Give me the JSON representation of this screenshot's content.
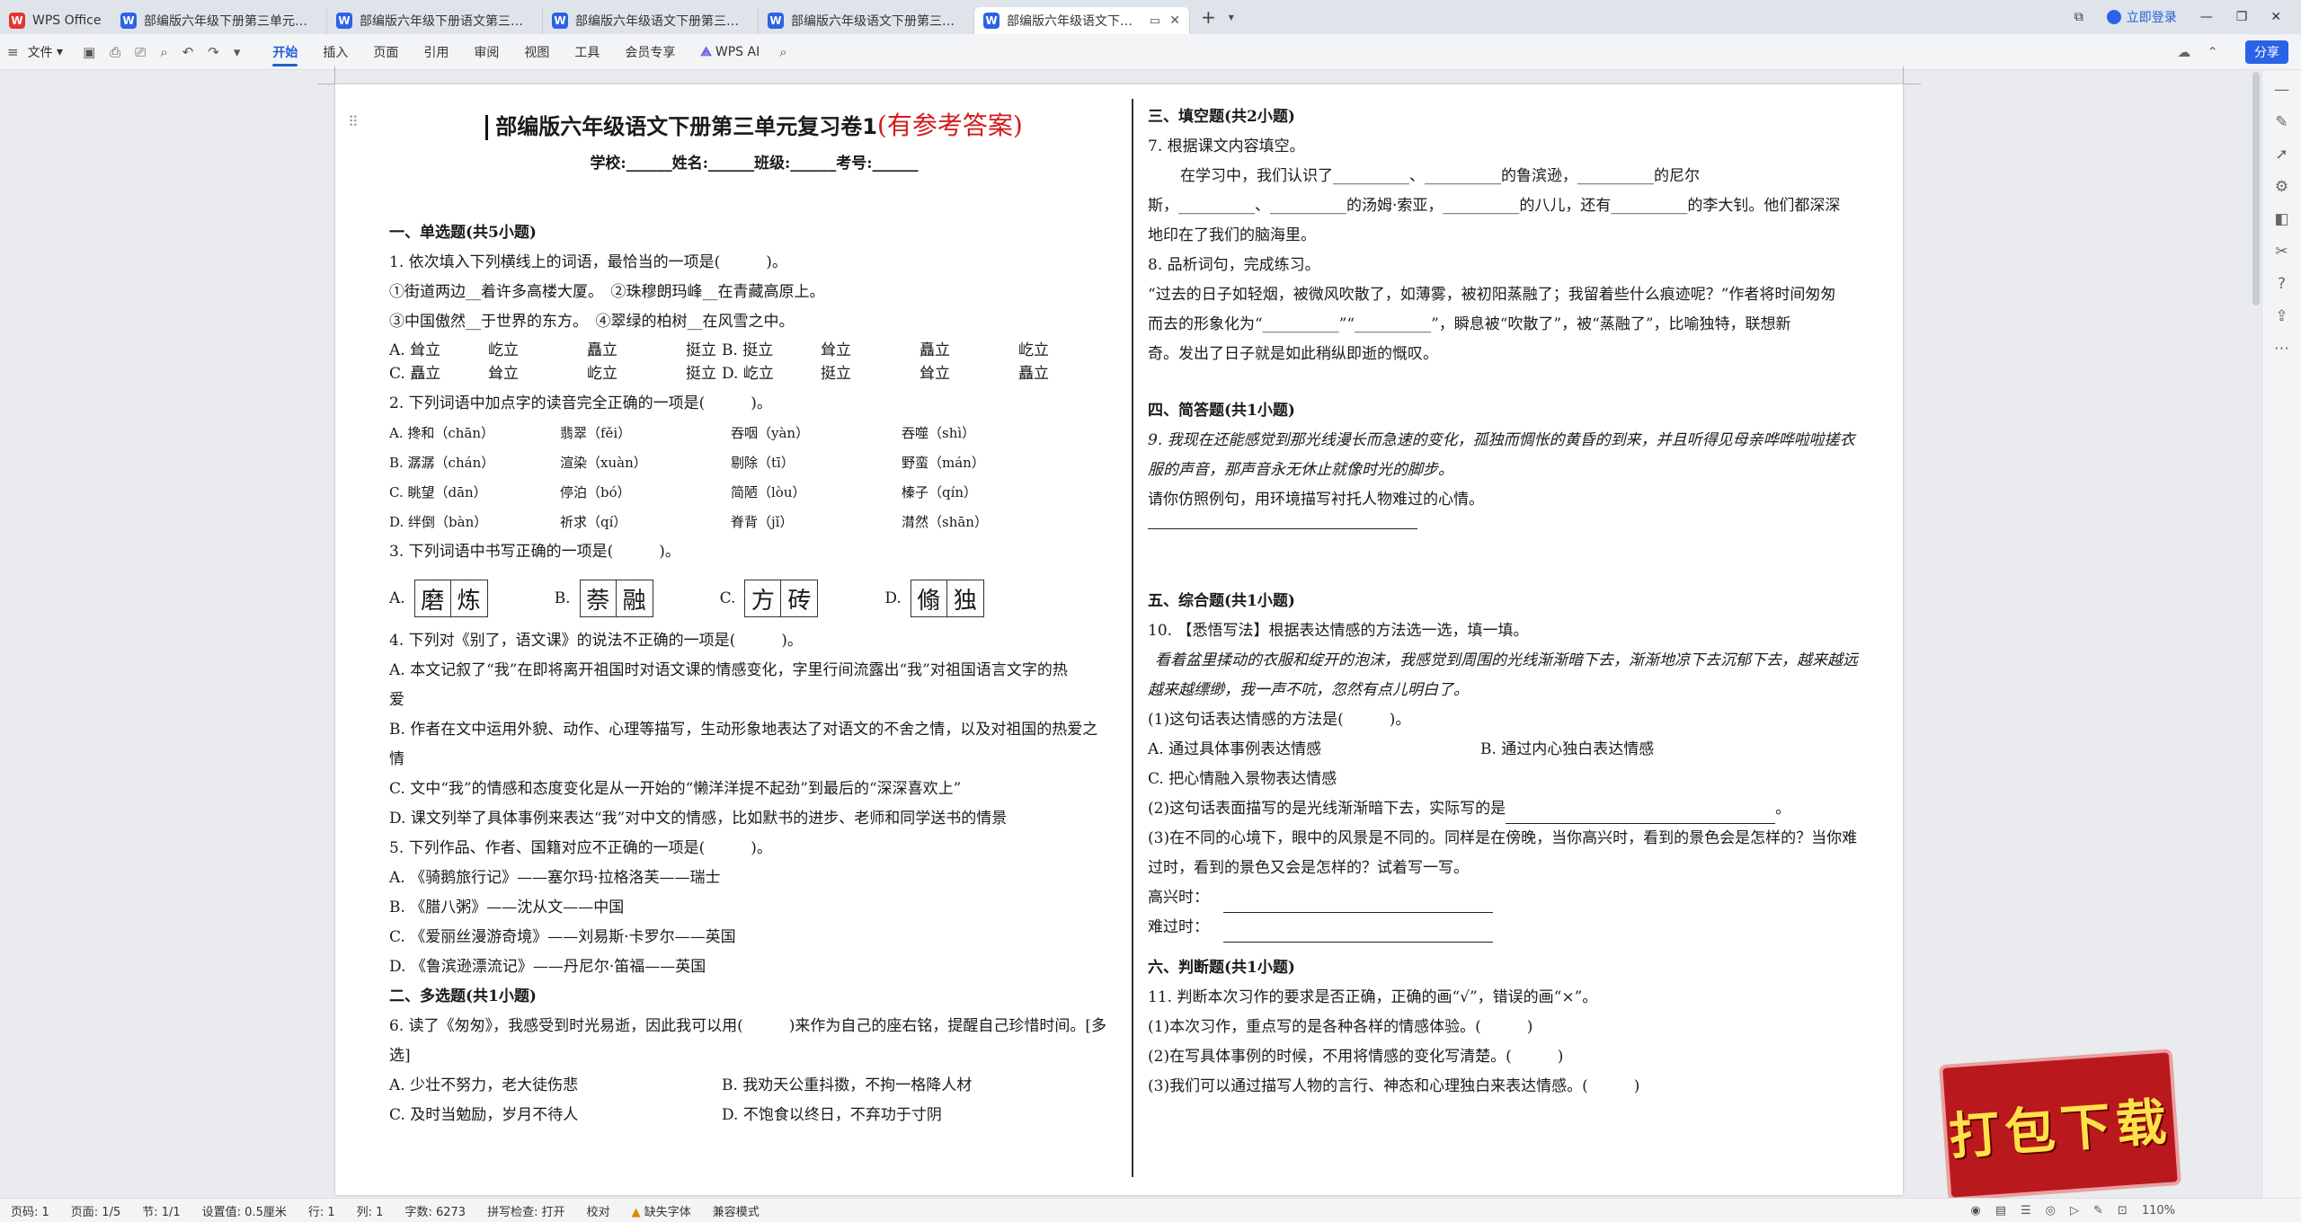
{
  "tabs": [
    {
      "label": "WPS Office",
      "icon": "wps-logo"
    },
    {
      "label": "部编版六年级下册第三单元复习卷.docx",
      "icon": "word-doc-icon"
    },
    {
      "label": "部编版六年级下册语文第三单元测试卷",
      "icon": "word-doc-icon"
    },
    {
      "label": "部编版六年级语文下册第三单元测试卷",
      "icon": "word-doc-icon"
    },
    {
      "label": "部编版六年级语文下册第三单元",
      "icon": "word-doc-icon"
    },
    {
      "label": "部编版六年级语文下册第三单元",
      "icon": "word-doc-icon"
    }
  ],
  "titlebar": {
    "login": "立即登录"
  },
  "menu": {
    "file": "文件",
    "items": [
      "开始",
      "插入",
      "页面",
      "引用",
      "审阅",
      "视图",
      "工具",
      "会员专享"
    ],
    "ai": "WPS AI",
    "share": "分享"
  },
  "doc": {
    "title": "部编版六年级语文下册第三单元复习卷1",
    "title_red": "(有参考答案)",
    "subtitle": "学校:______姓名:______班级:______考号:______",
    "s1": "一、单选题(共5小题)",
    "q1": "1. 依次填入下列横线上的词语，最恰当的一项是(　　　)。",
    "q1a": "①街道两边__着许多高楼大厦。　②珠穆朗玛峰__在青藏高原上。",
    "q1b": "③中国傲然__于世界的东方。　④翠绿的柏树__在风雪之中。",
    "q1o1": [
      "A. 耸立",
      "屹立",
      "矗立",
      "挺立"
    ],
    "q1o2": [
      "B. 挺立",
      "耸立",
      "矗立",
      "屹立"
    ],
    "q1o3": [
      "C. 矗立",
      "耸立",
      "屹立",
      "挺立"
    ],
    "q1o4": [
      "D. 屹立",
      "挺立",
      "耸立",
      "矗立"
    ],
    "q2": "2. 下列词语中加点字的读音完全正确的一项是(　　　)。",
    "q2a": [
      "A. 搀和（chān）",
      "翡翠（fěi）",
      "吞咽（yàn）",
      "吞噬（shì）"
    ],
    "q2b": [
      "B. 潺潺（chán）",
      "渲染（xuàn）",
      "剔除（tī）",
      "野蛮（mán）"
    ],
    "q2c": [
      "C. 眺望（dān）",
      "停泊（bó）",
      "简陋（lòu）",
      "榛子（qín）"
    ],
    "q2d": [
      "D. 绊倒（bàn）",
      "祈求（qí）",
      "脊背（jǐ）",
      "潸然（shān）"
    ],
    "q3": "3. 下列词语中书写正确的一项是(　　　)。",
    "q3opts": [
      {
        "l": "A.",
        "c": [
          "磨",
          "炼"
        ]
      },
      {
        "l": "B.",
        "c": [
          "萘",
          "融"
        ]
      },
      {
        "l": "C.",
        "c": [
          "方",
          "砖"
        ]
      },
      {
        "l": "D.",
        "c": [
          "翛",
          "独"
        ]
      }
    ],
    "q4": "4. 下列对《别了，语文课》的说法不正确的一项是(　　　)。",
    "q4a": "A. 本文记叙了“我”在即将离开祖国时对语文课的情感变化，字里行间流露出“我”对祖国语言文字的热",
    "q4a2": "爱",
    "q4b": "B. 作者在文中运用外貌、动作、心理等描写，生动形象地表达了对语文的不舍之情，以及对祖国的热爱之",
    "q4b2": "情",
    "q4c": "C. 文中“我”的情感和态度变化是从一开始的“懒洋洋提不起劲”到最后的“深深喜欢上”",
    "q4d": "D. 课文列举了具体事例来表达“我”对中文的情感，比如默书的进步、老师和同学送书的情景",
    "q5": "5. 下列作品、作者、国籍对应不正确的一项是(　　　)。",
    "q5a": "A. 《骑鹅旅行记》——塞尔玛·拉格洛芙——瑞士",
    "q5b": "B. 《腊八粥》——沈从文——中国",
    "q5c": "C. 《爱丽丝漫游奇境》——刘易斯·卡罗尔——英国",
    "q5d": "D. 《鲁滨逊漂流记》——丹尼尔·笛福——英国",
    "s2": "二、多选题(共1小题)",
    "q6": "6. 读了《匆匆》，我感受到时光易逝，因此我可以用(　　　)来作为自己的座右铭，提醒自己珍惜时间。[多",
    "q6b": "选]",
    "q6o": [
      "A. 少壮不努力，老大徒伤悲",
      "B. 我劝天公重抖擞，不拘一格降人材",
      "C. 及时当勉励，岁月不待人",
      "D. 不饱食以终日，不弃功于寸阴"
    ],
    "s3": "三、填空题(共2小题)",
    "q7": "7. 根据课文内容填空。",
    "q7a": "在学习中，我们认识了__________、__________的鲁滨逊，__________的尼尔",
    "q7b": "斯，__________、__________的汤姆·索亚，__________的八儿，还有__________的李大钊。他们都深深",
    "q7c": "地印在了我们的脑海里。",
    "q8": "8. 品析词句，完成练习。",
    "q8a": "“过去的日子如轻烟，被微风吹散了，如薄雾，被初阳蒸融了；我留着些什么痕迹呢？”作者将时间匆匆",
    "q8b": "而去的形象化为“__________”“__________”，瞬息被“吹散了”，被“蒸融了”，比喻独特，联想新",
    "q8c": "奇。发出了日子就是如此稍纵即逝的慨叹。",
    "s4": "四、简答题(共1小题)",
    "q9a": "9. 我现在还能感觉到那光线漫长而急速的变化，孤独而惆怅的黄昏的到来，并且听得见母亲哗哗啦啦搓衣",
    "q9b": "服的声音，那声音永无休止就像时光的脚步。",
    "q9c": "请你仿照例句，用环境描写衬托人物难过的心情。",
    "s5": "五、综合题(共1小题)",
    "q10": "10. 【悉悟写法】根据表达情感的方法选一选，填一填。",
    "q10a": "看着盆里揉动的衣服和绽开的泡沫，我感觉到周围的光线渐渐暗下去，渐渐地凉下去沉郁下去，越来越远",
    "q10b": "越来越缥缈，我一声不吭，忽然有点儿明白了。",
    "q10c": "(1)这句话表达情感的方法是(　　　)。",
    "q10o": [
      "A. 通过具体事例表达情感",
      "B. 通过内心独白表达情感"
    ],
    "q10o2": "C. 把心情融入景物表达情感",
    "q10d": "(2)这句话表面描写的是光线渐渐暗下去，实际写的是",
    "q10e": "(3)在不同的心境下，眼中的风景是不同的。同样是在傍晚，当你高兴时，看到的景色会是怎样的？当你难",
    "q10f": "过时，看到的景色又会是怎样的？试着写一写。",
    "q10g": "高兴时：",
    "q10h": "难过时：",
    "s6": "六、判断题(共1小题)",
    "q11": "11. 判断本次习作的要求是否正确，正确的画“√”，错误的画“×”。",
    "q11a": "(1)本次习作，重点写的是各种各样的情感体验。(　　　)",
    "q11b": "(2)在写具体事例的时候，不用将情感的变化写清楚。(　　　)",
    "q11c": "(3)我们可以通过描写人物的言行、神态和心理独白来表达情感。(　　　)"
  },
  "status": {
    "page": "页码: 1",
    "pages": "页面: 1/5",
    "section": "节: 1/1",
    "setting": "设置值: 0.5厘米",
    "row": "行: 1",
    "col": "列: 1",
    "words": "字数: 6273",
    "spell": "拼写检查: 打开",
    "proof": "校对",
    "missing_font": "缺失字体",
    "compat": "兼容模式",
    "zoom": "110%"
  },
  "banner": "打包下载"
}
